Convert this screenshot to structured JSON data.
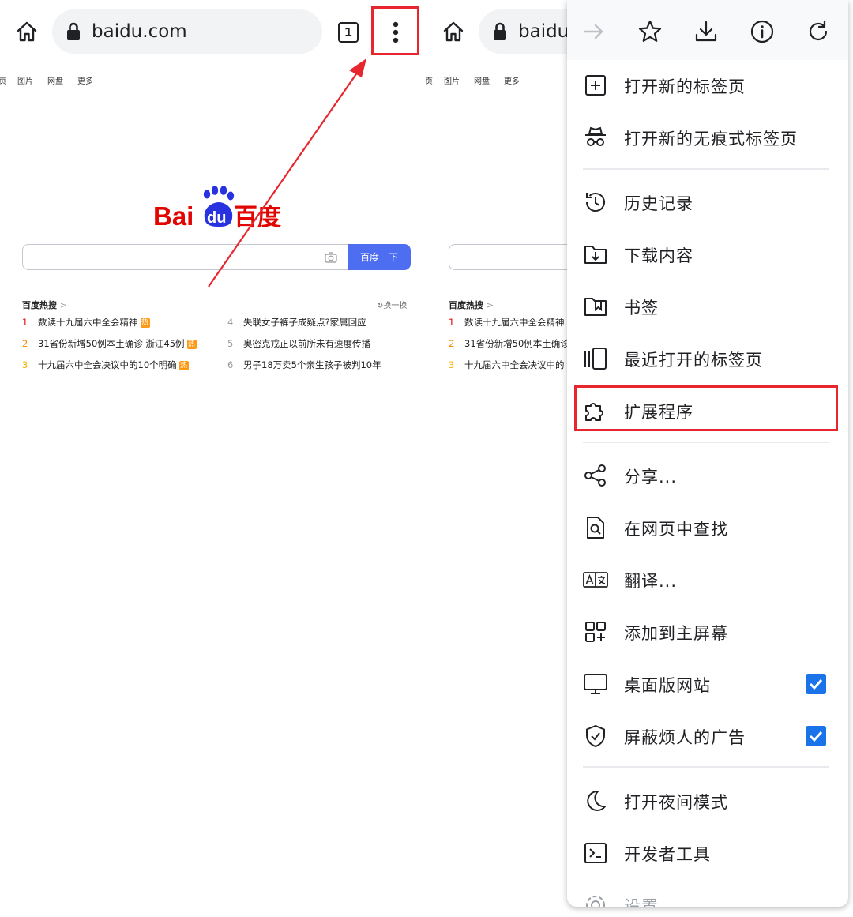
{
  "colors": {
    "accent": "#1a73e8",
    "highlight": "#e8262d",
    "baidu_blue": "#2932e1",
    "baidu_red": "#e10602",
    "search_button": "#4e6ef2"
  },
  "left": {
    "url": "baidu.com",
    "tab_count": "1",
    "nav_links": [
      "页",
      "图片",
      "网盘",
      "更多"
    ],
    "logo_text": {
      "bai": "Bai",
      "du": "du",
      "cn": "百度"
    },
    "search_button": "百度一下",
    "hot_title": "百度热搜",
    "refresh_label": "换一换",
    "hot_items": [
      {
        "num": "1",
        "text": "数读十九届六中全会精神",
        "hot": true
      },
      {
        "num": "2",
        "text": "31省份新增50例本土确诊 浙江45例",
        "hot": true
      },
      {
        "num": "3",
        "text": "十九届六中全会决议中的10个明确",
        "hot": true
      },
      {
        "num": "4",
        "text": "失联女子裤子成疑点?家属回应",
        "hot": false
      },
      {
        "num": "5",
        "text": "奥密克戎正以前所未有速度传播",
        "hot": false
      },
      {
        "num": "6",
        "text": "男子18万卖5个亲生孩子被判10年",
        "hot": false
      }
    ],
    "hot_badge": "热"
  },
  "right": {
    "url": "baidu.",
    "nav_links": [
      "页",
      "图片",
      "网盘",
      "更多"
    ],
    "hot_title": "百度热搜",
    "hot_items_truncated": [
      {
        "num": "1",
        "text": "数读十九届六中全会精神"
      },
      {
        "num": "2",
        "text": "31省份新增50例本土确诊"
      },
      {
        "num": "3",
        "text": "十九届六中全会决议中的"
      }
    ],
    "menu": {
      "toolbar_icons": [
        "forward-icon",
        "star-icon",
        "download-icon",
        "info-icon",
        "reload-icon"
      ],
      "items": [
        {
          "label": "打开新的标签页",
          "icon": "new-tab-icon"
        },
        {
          "label": "打开新的无痕式标签页",
          "icon": "incognito-icon"
        },
        {
          "label": "历史记录",
          "icon": "history-icon"
        },
        {
          "label": "下载内容",
          "icon": "downloads-icon"
        },
        {
          "label": "书签",
          "icon": "bookmarks-icon"
        },
        {
          "label": "最近打开的标签页",
          "icon": "recent-tabs-icon"
        },
        {
          "label": "扩展程序",
          "icon": "extensions-icon"
        },
        {
          "label": "分享...",
          "icon": "share-icon"
        },
        {
          "label": "在网页中查找",
          "icon": "find-in-page-icon"
        },
        {
          "label": "翻译...",
          "icon": "translate-icon"
        },
        {
          "label": "添加到主屏幕",
          "icon": "add-to-home-icon"
        },
        {
          "label": "桌面版网站",
          "icon": "desktop-site-icon",
          "checked": true
        },
        {
          "label": "屏蔽烦人的广告",
          "icon": "ad-block-icon",
          "checked": true
        },
        {
          "label": "打开夜间模式",
          "icon": "night-mode-icon"
        },
        {
          "label": "开发者工具",
          "icon": "dev-tools-icon"
        },
        {
          "label": "设置",
          "icon": "settings-icon"
        }
      ]
    }
  }
}
